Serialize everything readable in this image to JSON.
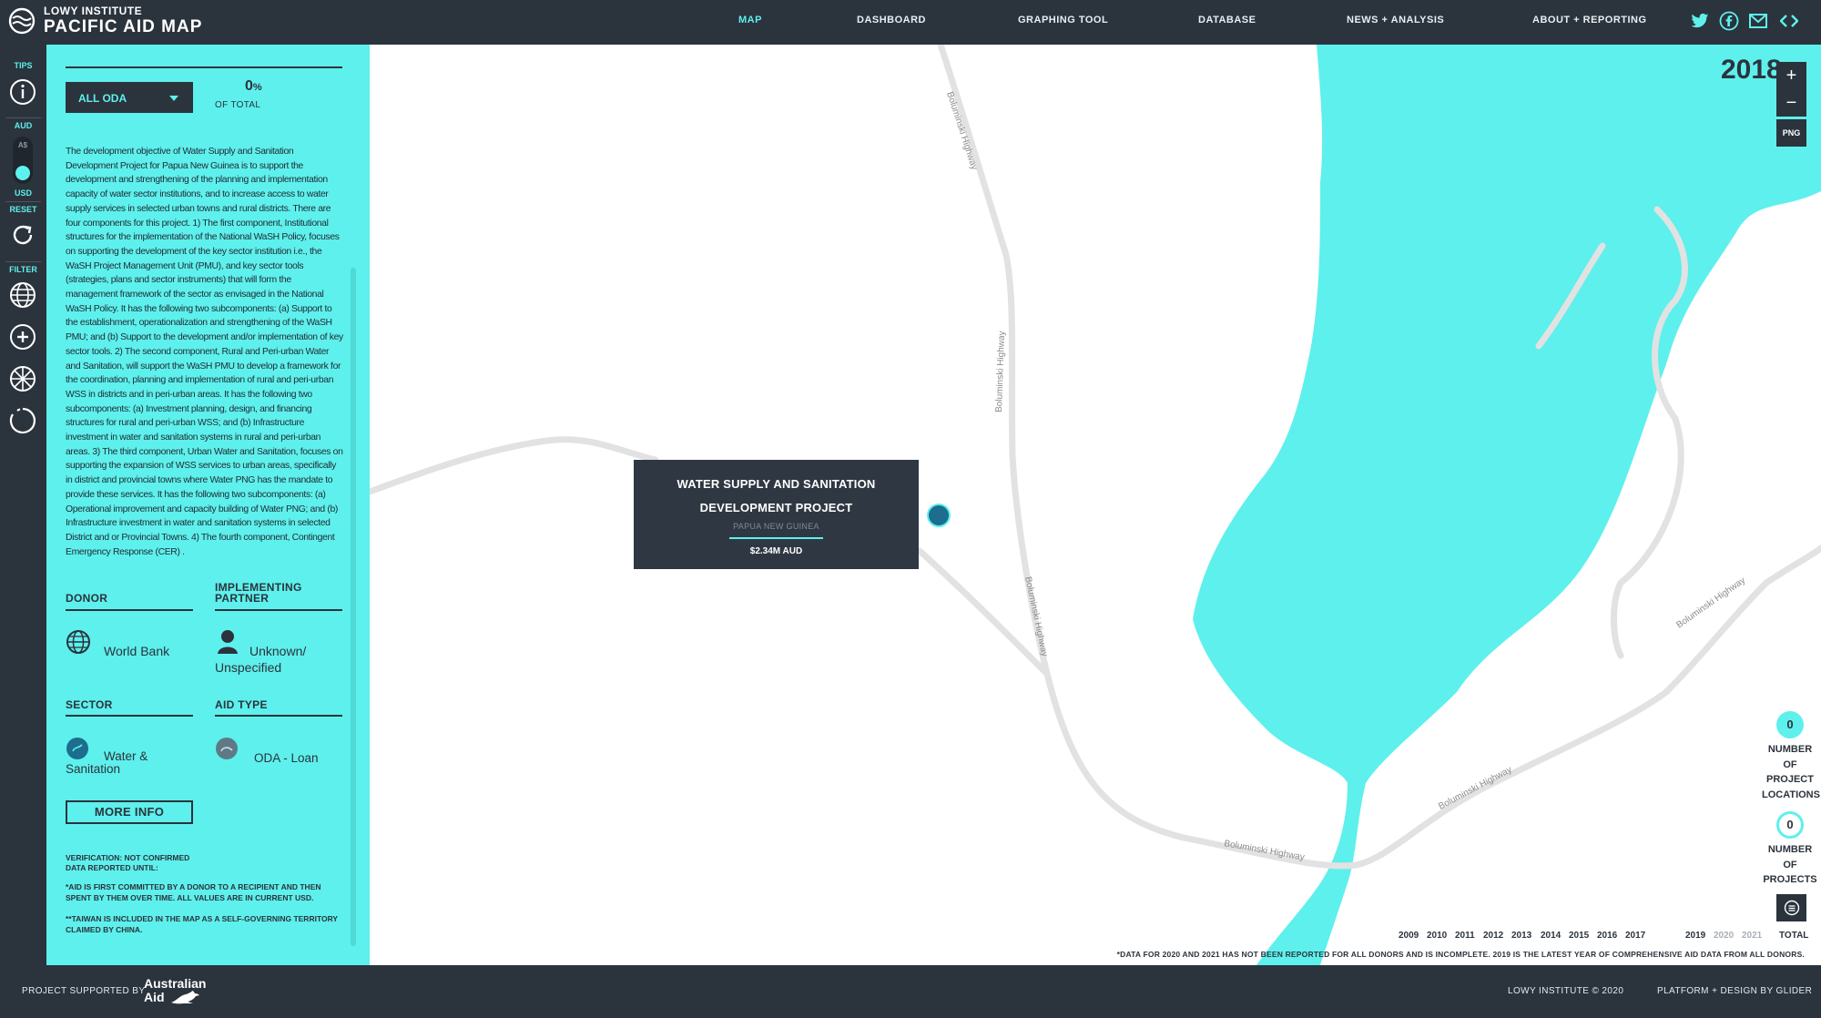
{
  "app": {
    "org": "LOWY INSTITUTE",
    "title": "PACIFIC AID MAP"
  },
  "nav": [
    "MAP",
    "DASHBOARD",
    "GRAPHING TOOL",
    "DATABASE",
    "NEWS + ANALYSIS",
    "ABOUT + REPORTING"
  ],
  "social_icons": [
    "twitter-icon",
    "facebook-icon",
    "email-icon",
    "embed-icon"
  ],
  "rail": {
    "tips": "TIPS",
    "aud": "AUD",
    "a_dollar": "A$",
    "usd": "USD",
    "reset": "RESET",
    "filter": "FILTER"
  },
  "panel": {
    "oda_select": "ALL ODA",
    "percent_value": "0",
    "percent_unit": "%",
    "percent_label": "OF TOTAL",
    "description": "The development objective of Water Supply and Sanitation Development Project for Papua New Guinea is to support the development and strengthening of the planning and implementation capacity of water sector institutions, and to increase access to water supply services in selected urban towns and rural districts. There are four components for this project. 1) The first component, Institutional structures for the implementation of the National WaSH Policy, focuses on supporting the development of the key sector institution i.e., the WaSH Project Management Unit (PMU), and key sector tools (strategies, plans and sector instruments) that will form the management framework of the sector as envisaged in the National WaSH Policy. It has the following two subcomponents: (a) Support to the establishment, operationalization and strengthening of the WaSH PMU; and (b) Support to the development and/or implementation of key sector tools. 2) The second component, Rural and Peri-urban Water and Sanitation, will support the WaSH PMU to develop a framework for the coordination, planning and implementation of rural and peri-urban WSS in districts and in peri-urban areas. It has the following two subcomponents: (a) Investment planning, design, and financing structures for rural and peri-urban WSS; and (b) Infrastructure investment in water and sanitation systems in rural and peri-urban areas. 3) The third component, Urban Water and Sanitation, focuses on supporting the expansion of WSS services to urban areas, specifically in district and provincial towns where Water PNG has the mandate to provide these services. It has the following two subcomponents: (a) Operational improvement and capacity building of Water PNG; and (b) Infrastructure investment in water and sanitation systems in selected District and or Provincial Towns. 4) The fourth component, Contingent Emergency Response (CER) .",
    "donor_heading": "DONOR",
    "donor": "World Bank",
    "partner_heading": "IMPLEMENTING PARTNER",
    "partner": "Unknown/ Unspecified",
    "sector_heading": "SECTOR",
    "sector": "Water & Sanitation",
    "aidtype_heading": "AID TYPE",
    "aidtype": "ODA - Loan",
    "more_info": "MORE INFO",
    "verification": "VERIFICATION: NOT CONFIRMED",
    "reported_until": "DATA REPORTED UNTIL:",
    "note1": "*AID IS FIRST COMMITTED BY A DONOR TO A RECIPIENT AND THEN SPENT BY THEM OVER TIME. ALL VALUES ARE IN CURRENT USD.",
    "note2": "**TAIWAN IS INCLUDED IN THE MAP AS A SELF-GOVERNING TERRITORY CLAIMED BY CHINA."
  },
  "map": {
    "year": "2018",
    "zoom_in": "+",
    "zoom_out": "−",
    "png": "PNG",
    "road_label": "Boluminski Highway",
    "popup": {
      "title": "WATER SUPPLY AND SANITATION DEVELOPMENT PROJECT",
      "country": "PAPUA NEW GUINEA",
      "value": "$2.34M AUD"
    },
    "locations_count": "0",
    "locations_label": "NUMBER OF PROJECT LOCATIONS",
    "projects_count": "0",
    "projects_label": "NUMBER OF PROJECTS",
    "years": [
      "2009",
      "2010",
      "2011",
      "2012",
      "2013",
      "2014",
      "2015",
      "2016",
      "2017",
      "2019",
      "2020",
      "2021",
      "TOTAL"
    ],
    "note": "*DATA FOR 2020 AND 2021 HAS NOT BEEN REPORTED FOR ALL DONORS AND IS INCOMPLETE. 2019 IS THE LATEST YEAR OF COMPREHENSIVE AID DATA FROM ALL DONORS.",
    "colors": {
      "water": "#5ef0ec",
      "road": "#e0e0e0",
      "panel": "#2b333d"
    }
  },
  "footer": {
    "supported_by": "PROJECT SUPPORTED BY",
    "sponsor_line1": "Australian",
    "sponsor_line2": "Aid",
    "copyright": "LOWY INSTITUTE © 2020",
    "credit": "PLATFORM + DESIGN BY GLIDER"
  }
}
